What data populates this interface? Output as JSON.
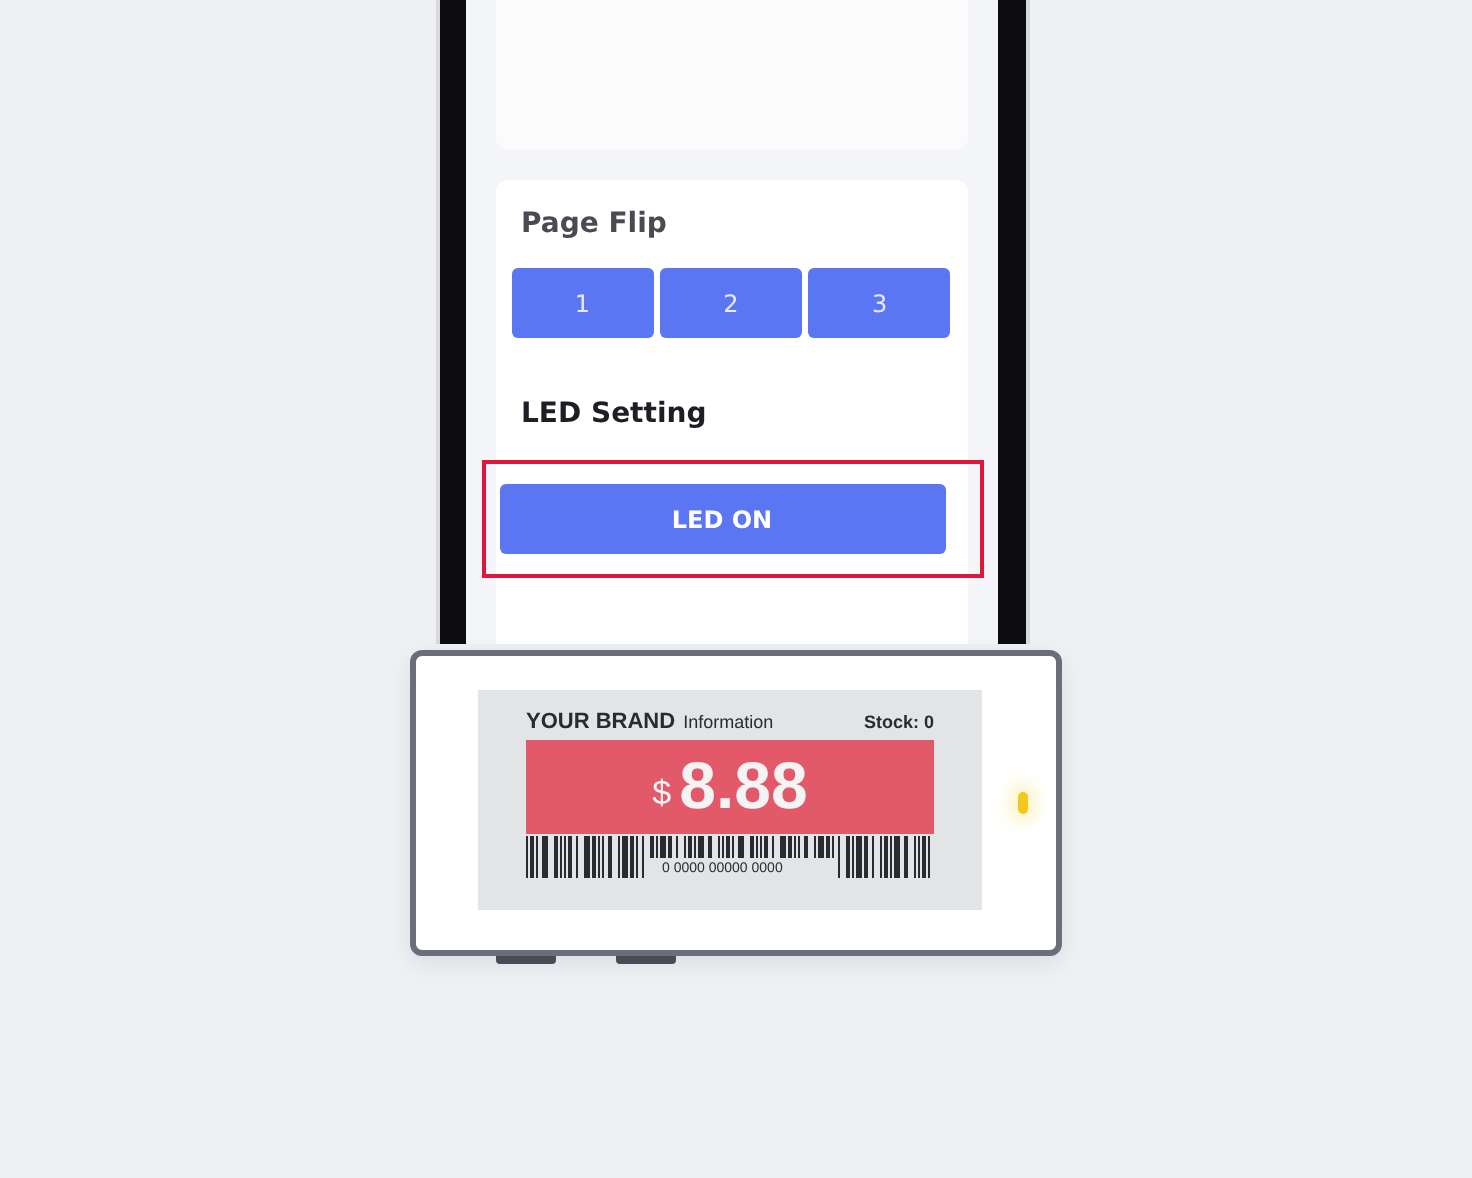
{
  "page_flip": {
    "title": "Page Flip",
    "buttons": [
      "1",
      "2",
      "3"
    ]
  },
  "led_setting": {
    "title": "LED Setting",
    "button": "LED ON",
    "highlighted": true
  },
  "price_tag": {
    "brand": "YOUR BRAND",
    "info": "Information",
    "stock": "Stock: 0",
    "currency": "$",
    "price": "8.88",
    "barcode_number": "0 0000 00000 0000",
    "led_on": true
  }
}
